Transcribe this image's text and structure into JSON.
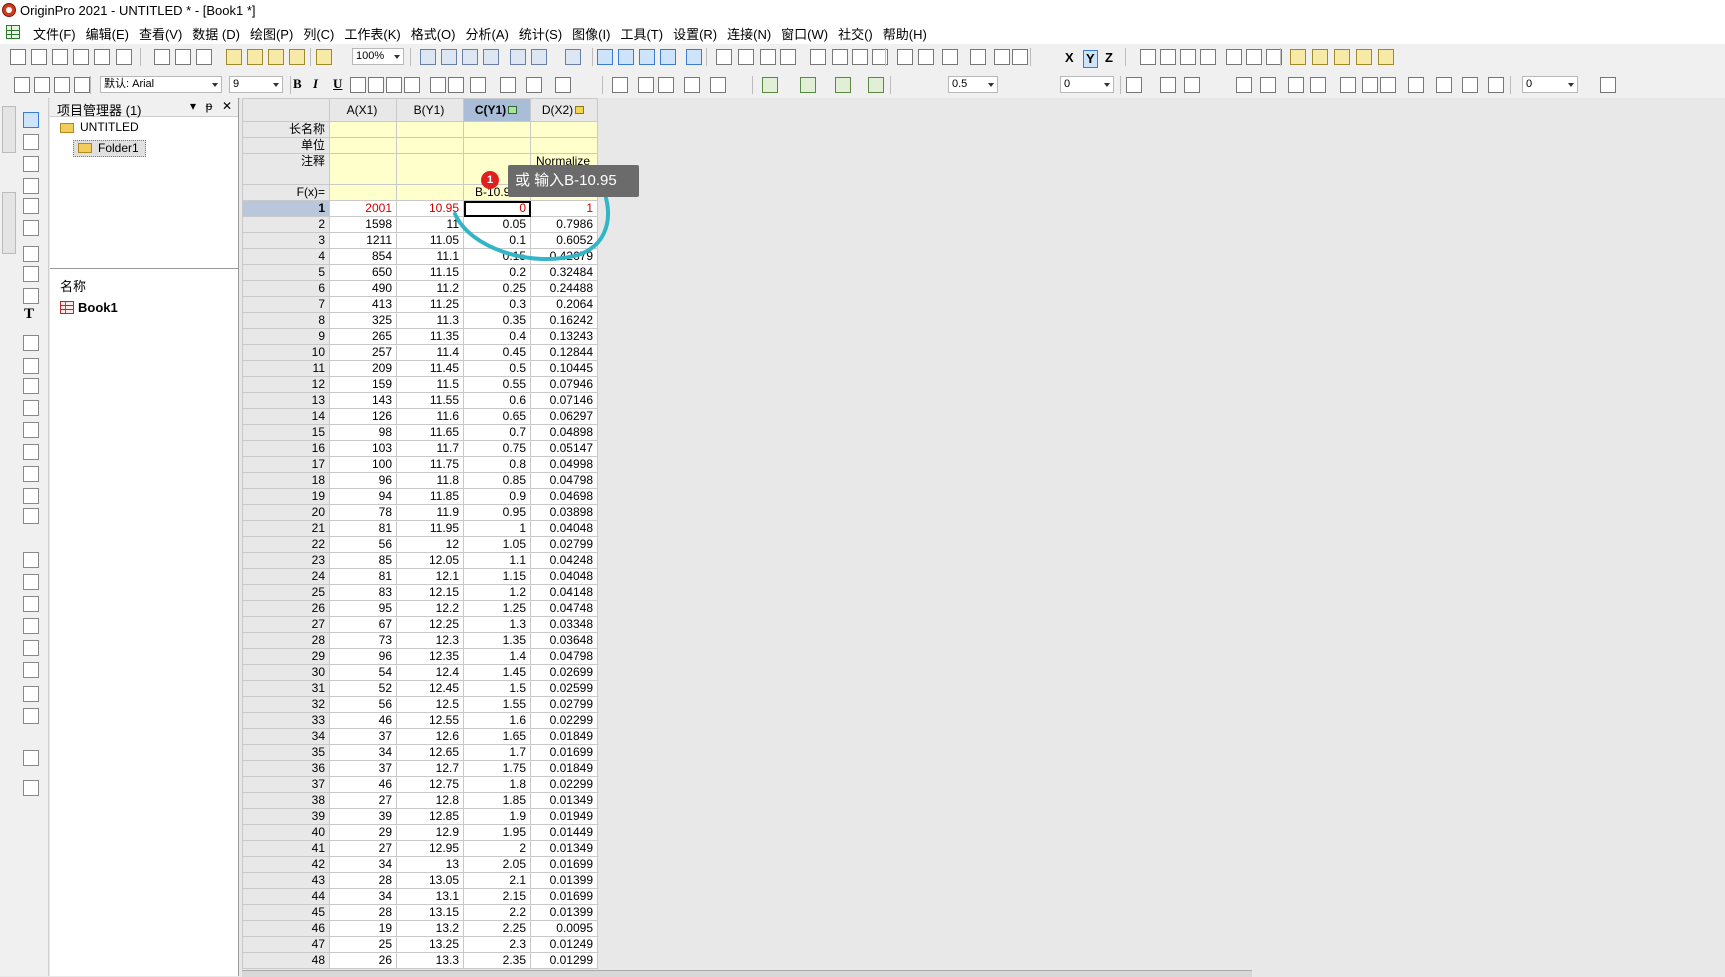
{
  "window": {
    "title": "OriginPro 2021 - UNTITLED * - [Book1 *]"
  },
  "menu": [
    "文件(F)",
    "编辑(E)",
    "查看(V)",
    "数据 (D)",
    "绘图(P)",
    "列(C)",
    "工作表(K)",
    "格式(O)",
    "分析(A)",
    "统计(S)",
    "图像(I)",
    "工具(T)",
    "设置(R)",
    "连接(N)",
    "窗口(W)",
    "社交()",
    "帮助(H)"
  ],
  "toolbar": {
    "zoom": "100%",
    "font": "默认: Arial",
    "font_size": "9",
    "line_width": "0.5",
    "value1": "0",
    "value2": "0",
    "axis_letters": {
      "x": "X",
      "y": "Y",
      "z": "Z"
    }
  },
  "project_manager": {
    "title": "项目管理器 (1)",
    "root": "UNTITLED",
    "folder": "Folder1",
    "list_header": "名称",
    "book": "Book1"
  },
  "worksheet": {
    "columns": [
      {
        "label": "A(X1)",
        "selected": false,
        "lock": ""
      },
      {
        "label": "B(Y1)",
        "selected": false,
        "lock": ""
      },
      {
        "label": "C(Y1)",
        "selected": true,
        "lock": "green"
      },
      {
        "label": "D(X2)",
        "selected": false,
        "lock": "yellow"
      }
    ],
    "meta_labels": [
      "长名称",
      "单位",
      "注释",
      "F(x)="
    ],
    "comment_d": "Normalize",
    "fx_c": "B-10.95",
    "rows": [
      [
        "1",
        "2001",
        "10.95",
        "0",
        "1"
      ],
      [
        "2",
        "1598",
        "11",
        "0.05",
        "0.7986"
      ],
      [
        "3",
        "1211",
        "11.05",
        "0.1",
        "0.6052"
      ],
      [
        "4",
        "854",
        "11.1",
        "0.15",
        "0.42679"
      ],
      [
        "5",
        "650",
        "11.15",
        "0.2",
        "0.32484"
      ],
      [
        "6",
        "490",
        "11.2",
        "0.25",
        "0.24488"
      ],
      [
        "7",
        "413",
        "11.25",
        "0.3",
        "0.2064"
      ],
      [
        "8",
        "325",
        "11.3",
        "0.35",
        "0.16242"
      ],
      [
        "9",
        "265",
        "11.35",
        "0.4",
        "0.13243"
      ],
      [
        "10",
        "257",
        "11.4",
        "0.45",
        "0.12844"
      ],
      [
        "11",
        "209",
        "11.45",
        "0.5",
        "0.10445"
      ],
      [
        "12",
        "159",
        "11.5",
        "0.55",
        "0.07946"
      ],
      [
        "13",
        "143",
        "11.55",
        "0.6",
        "0.07146"
      ],
      [
        "14",
        "126",
        "11.6",
        "0.65",
        "0.06297"
      ],
      [
        "15",
        "98",
        "11.65",
        "0.7",
        "0.04898"
      ],
      [
        "16",
        "103",
        "11.7",
        "0.75",
        "0.05147"
      ],
      [
        "17",
        "100",
        "11.75",
        "0.8",
        "0.04998"
      ],
      [
        "18",
        "96",
        "11.8",
        "0.85",
        "0.04798"
      ],
      [
        "19",
        "94",
        "11.85",
        "0.9",
        "0.04698"
      ],
      [
        "20",
        "78",
        "11.9",
        "0.95",
        "0.03898"
      ],
      [
        "21",
        "81",
        "11.95",
        "1",
        "0.04048"
      ],
      [
        "22",
        "56",
        "12",
        "1.05",
        "0.02799"
      ],
      [
        "23",
        "85",
        "12.05",
        "1.1",
        "0.04248"
      ],
      [
        "24",
        "81",
        "12.1",
        "1.15",
        "0.04048"
      ],
      [
        "25",
        "83",
        "12.15",
        "1.2",
        "0.04148"
      ],
      [
        "26",
        "95",
        "12.2",
        "1.25",
        "0.04748"
      ],
      [
        "27",
        "67",
        "12.25",
        "1.3",
        "0.03348"
      ],
      [
        "28",
        "73",
        "12.3",
        "1.35",
        "0.03648"
      ],
      [
        "29",
        "96",
        "12.35",
        "1.4",
        "0.04798"
      ],
      [
        "30",
        "54",
        "12.4",
        "1.45",
        "0.02699"
      ],
      [
        "31",
        "52",
        "12.45",
        "1.5",
        "0.02599"
      ],
      [
        "32",
        "56",
        "12.5",
        "1.55",
        "0.02799"
      ],
      [
        "33",
        "46",
        "12.55",
        "1.6",
        "0.02299"
      ],
      [
        "34",
        "37",
        "12.6",
        "1.65",
        "0.01849"
      ],
      [
        "35",
        "34",
        "12.65",
        "1.7",
        "0.01699"
      ],
      [
        "36",
        "37",
        "12.7",
        "1.75",
        "0.01849"
      ],
      [
        "37",
        "46",
        "12.75",
        "1.8",
        "0.02299"
      ],
      [
        "38",
        "27",
        "12.8",
        "1.85",
        "0.01349"
      ],
      [
        "39",
        "39",
        "12.85",
        "1.9",
        "0.01949"
      ],
      [
        "40",
        "29",
        "12.9",
        "1.95",
        "0.01449"
      ],
      [
        "41",
        "27",
        "12.95",
        "2",
        "0.01349"
      ],
      [
        "42",
        "34",
        "13",
        "2.05",
        "0.01699"
      ],
      [
        "43",
        "28",
        "13.05",
        "2.1",
        "0.01399"
      ],
      [
        "44",
        "34",
        "13.1",
        "2.15",
        "0.01699"
      ],
      [
        "45",
        "28",
        "13.15",
        "2.2",
        "0.01399"
      ],
      [
        "46",
        "19",
        "13.2",
        "2.25",
        "0.0095"
      ],
      [
        "47",
        "25",
        "13.25",
        "2.3",
        "0.01249"
      ],
      [
        "48",
        "26",
        "13.3",
        "2.35",
        "0.01299"
      ]
    ]
  },
  "tooltip": {
    "badge": "1",
    "text": "或 输入B-10.95"
  },
  "colors": {
    "meta_bg": "#ffffcc",
    "header_selected": "#a9bcd8",
    "first_row_text": "#cc0000",
    "annotation": "#33b5c8",
    "tooltip_bg": "#6b6b6b",
    "badge": "#e02020"
  }
}
